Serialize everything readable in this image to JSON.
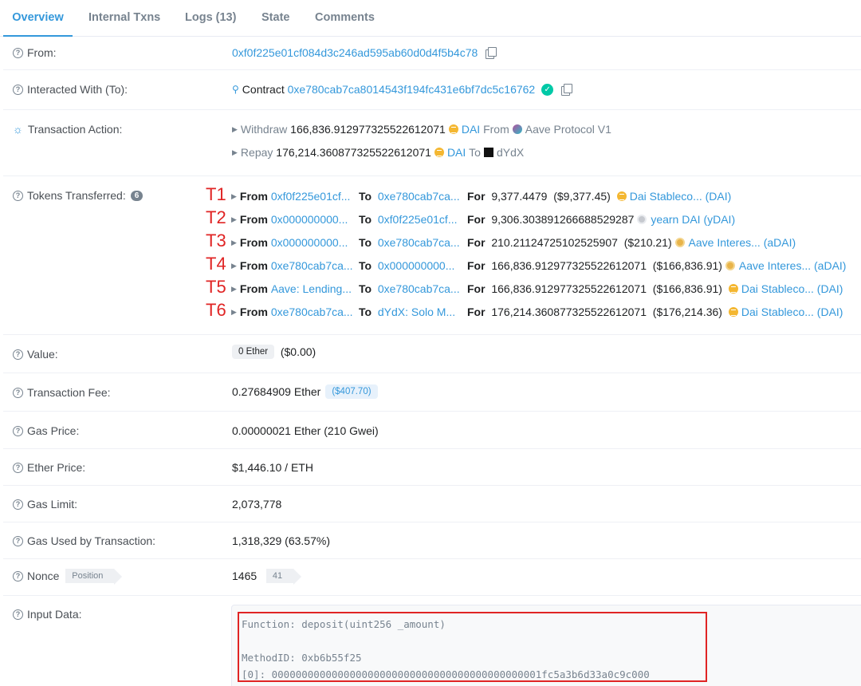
{
  "tabs": [
    {
      "label": "Overview"
    },
    {
      "label": "Internal Txns"
    },
    {
      "label": "Logs (13)"
    },
    {
      "label": "State"
    },
    {
      "label": "Comments"
    }
  ],
  "from": {
    "label": "From:",
    "address": "0xf0f225e01cf084d3c246ad595ab60d0d4f5b4c78"
  },
  "interacted": {
    "label": "Interacted With (To):",
    "prefix": "Contract",
    "address": "0xe780cab7ca8014543f194fc431e6bf7dc5c16762"
  },
  "action": {
    "label": "Transaction Action:",
    "lines": [
      {
        "verb": "Withdraw",
        "amount": "166,836.912977325522612071",
        "token": "DAI",
        "prep": "From",
        "party": "Aave Protocol V1"
      },
      {
        "verb": "Repay",
        "amount": "176,214.360877325522612071",
        "token": "DAI",
        "prep": "To",
        "party": "dYdX"
      }
    ]
  },
  "tokens": {
    "label": "Tokens Transferred:",
    "count": "6",
    "from_word": "From",
    "to_word": "To",
    "for_word": "For",
    "transfers": [
      {
        "tag": "T1",
        "from": "0xf0f225e01cf...",
        "to": "0xe780cab7ca...",
        "amount": "9,377.4479",
        "usd": "($9,377.45)",
        "icon": "dai-icon",
        "token": "Dai Stableco... (DAI)"
      },
      {
        "tag": "T2",
        "from": "0x000000000...",
        "to": "0xf0f225e01cf...",
        "amount": "9,306.303891266688529287",
        "usd": "",
        "icon": "ydai-icon",
        "token": "yearn DAI (yDAI)"
      },
      {
        "tag": "T3",
        "from": "0x000000000...",
        "to": "0xe780cab7ca...",
        "amount": "210.21124725102525907",
        "usd": "($210.21)",
        "icon": "adai-icon",
        "token": "Aave Interes... (aDAI)"
      },
      {
        "tag": "T4",
        "from": "0xe780cab7ca...",
        "to": "0x000000000...",
        "amount": "166,836.912977325522612071",
        "usd": "($166,836.91)",
        "icon": "adai-icon",
        "token": "Aave Interes... (aDAI)"
      },
      {
        "tag": "T5",
        "from": "Aave: Lending...",
        "to": "0xe780cab7ca...",
        "amount": "166,836.912977325522612071",
        "usd": "($166,836.91)",
        "icon": "dai-icon",
        "token": "Dai Stableco... (DAI)"
      },
      {
        "tag": "T6",
        "from": "0xe780cab7ca...",
        "to": "dYdX: Solo M...",
        "amount": "176,214.360877325522612071",
        "usd": "($176,214.36)",
        "icon": "dai-icon",
        "token": "Dai Stableco... (DAI)"
      }
    ]
  },
  "value": {
    "label": "Value:",
    "pill": "0 Ether",
    "usd": "($0.00)"
  },
  "fee": {
    "label": "Transaction Fee:",
    "amount": "0.27684909 Ether",
    "usd": "($407.70)"
  },
  "gas_price": {
    "label": "Gas Price:",
    "value": "0.00000021 Ether (210 Gwei)"
  },
  "ether_price": {
    "label": "Ether Price:",
    "value": "$1,446.10 / ETH"
  },
  "gas_limit": {
    "label": "Gas Limit:",
    "value": "2,073,778"
  },
  "gas_used": {
    "label": "Gas Used by Transaction:",
    "value": "1,318,329 (63.57%)"
  },
  "nonce": {
    "label": "Nonce",
    "position_tag": "Position",
    "value": "1465",
    "position": "41"
  },
  "input": {
    "label": "Input Data:",
    "function": "Function: deposit(uint256 _amount)",
    "method": "MethodID: 0xb6b55f25",
    "param": "[0]:  000000000000000000000000000000000000000000001fc5a3b6d33a0c9c000"
  },
  "colors": {
    "link": "#3498db",
    "annotation": "#e02424",
    "muted": "#77838f"
  }
}
